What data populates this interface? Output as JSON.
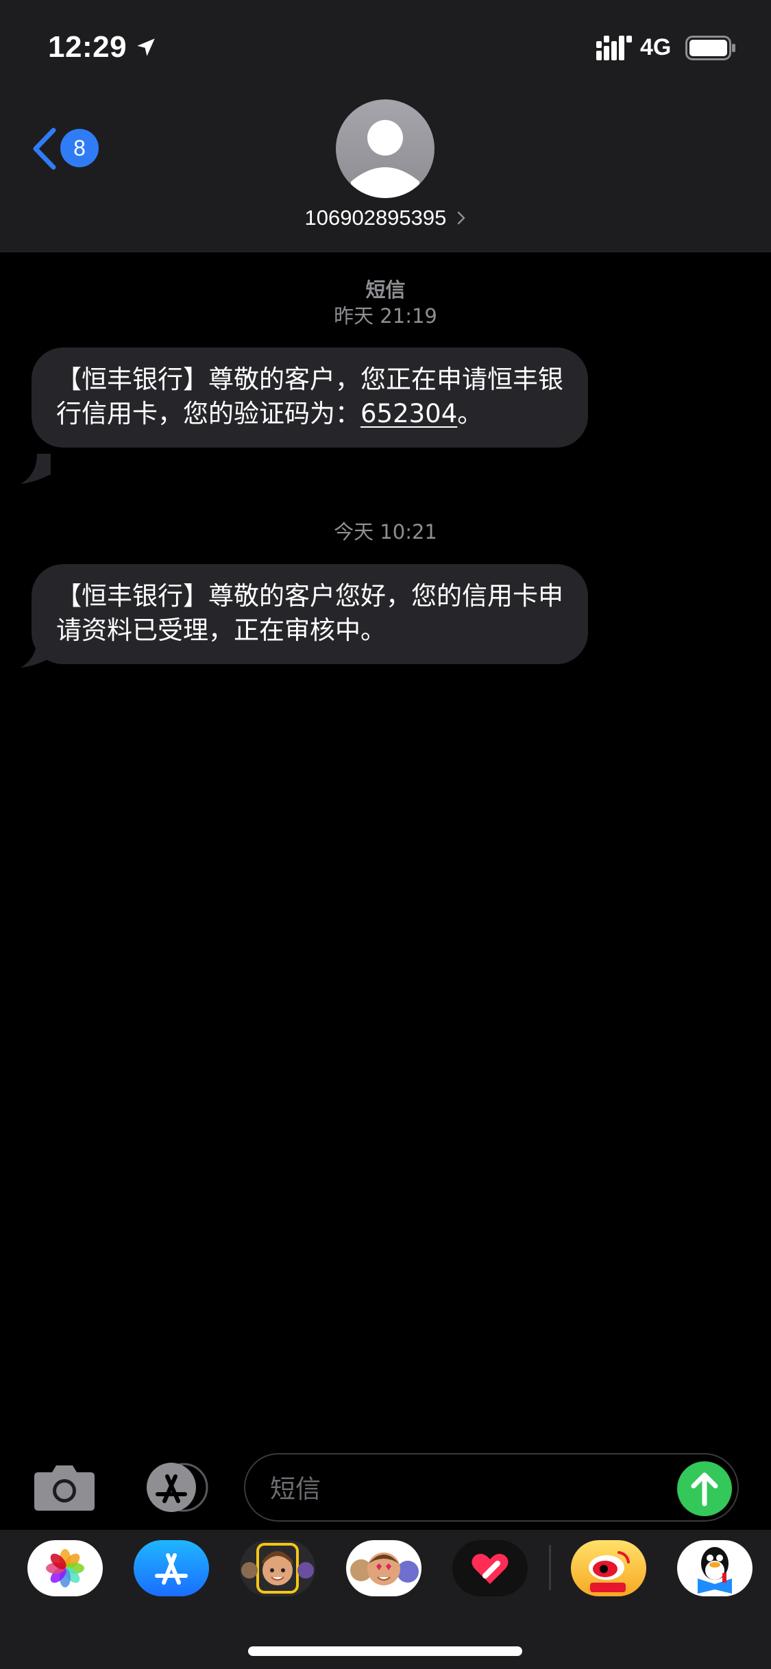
{
  "status_bar": {
    "time": "12:29",
    "network": "4G",
    "icons": [
      "location-arrow-icon",
      "signal-icon",
      "battery-icon"
    ]
  },
  "header": {
    "back_count": "8",
    "contact": "106902895395",
    "icons": [
      "back-chevron-icon",
      "avatar-icon",
      "chevron-right-icon"
    ]
  },
  "messages": [
    {
      "service": "短信",
      "time": "昨天 21:19",
      "text_before": "【恒丰银行】尊敬的客户，您正在申请恒丰银行信用卡，您的验证码为：",
      "code": "652304",
      "text_after": "。"
    },
    {
      "time": "今天 10:21",
      "text": "【恒丰银行】尊敬的客户您好，您的信用卡申请资料已受理，正在审核中。"
    }
  ],
  "input_bar": {
    "placeholder": "短信",
    "icons": [
      "camera-icon",
      "app-store-icon",
      "send-arrow-icon"
    ]
  },
  "app_drawer": {
    "apps": [
      "photos-icon",
      "app-store-icon",
      "memoji-icon",
      "animoji-stickers-icon",
      "digital-touch-icon",
      "weibo-icon",
      "qq-icon"
    ]
  },
  "colors": {
    "header_bg": "#1d1d1f",
    "bubble_bg": "#26252a",
    "accent_blue": "#2f7cf6",
    "send_green": "#34c759",
    "timestamp_gray": "#8e8e93"
  }
}
